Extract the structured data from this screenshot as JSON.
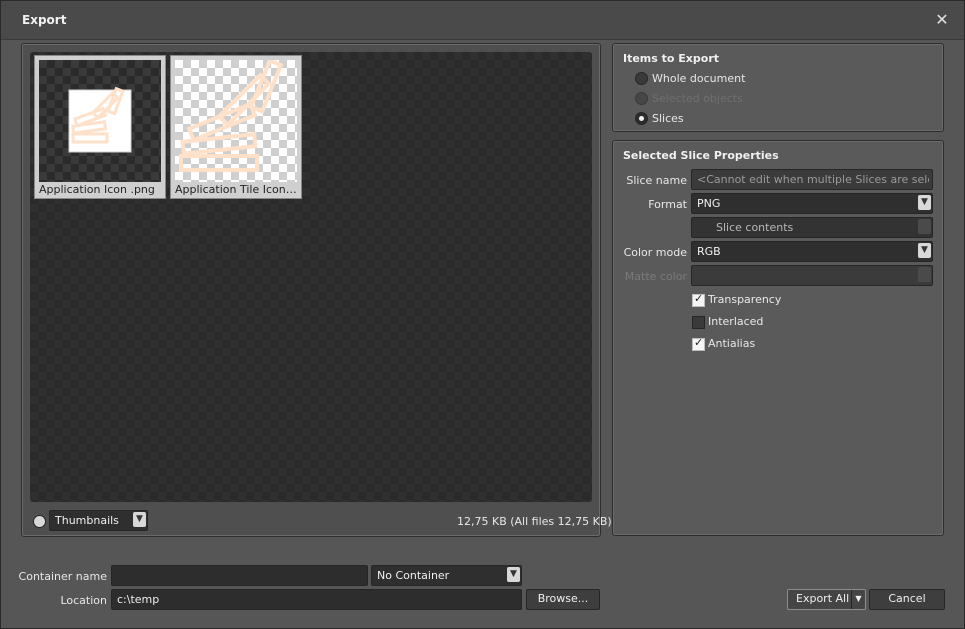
{
  "window": {
    "title": "Export"
  },
  "preview": {
    "thumbnails": [
      {
        "label": "Application Icon .png"
      },
      {
        "label": "Application Tile Icon...."
      }
    ],
    "view_mode": "Thumbnails",
    "size_info": "12,75 KB (All files 12,75 KB)"
  },
  "items_to_export": {
    "heading": "Items to Export",
    "options": [
      {
        "label": "Whole document",
        "selected": false,
        "enabled": true
      },
      {
        "label": "Selected objects",
        "selected": false,
        "enabled": false
      },
      {
        "label": "Slices",
        "selected": true,
        "enabled": true
      }
    ]
  },
  "slice_properties": {
    "heading": "Selected Slice Properties",
    "slice_name_label": "Slice name",
    "slice_name_value": "<Cannot edit when multiple Slices are selec...",
    "format_label": "Format",
    "format_value": "PNG",
    "slice_contents_value": "Slice contents",
    "color_mode_label": "Color mode",
    "color_mode_value": "RGB",
    "matte_color_label": "Matte color",
    "transparency_label": "Transparency",
    "transparency_checked": true,
    "interlaced_label": "Interlaced",
    "interlaced_checked": false,
    "antialias_label": "Antialias",
    "antialias_checked": true
  },
  "footer": {
    "container_name_label": "Container name",
    "container_name_value": "",
    "container_select_value": "No Container",
    "location_label": "Location",
    "location_value": "c:\\temp",
    "browse_label": "Browse...",
    "export_all_label": "Export All",
    "cancel_label": "Cancel"
  },
  "colors": {
    "background": "#565656",
    "field": "#2d2d2d",
    "accent_icon": "#ffd9c0"
  }
}
